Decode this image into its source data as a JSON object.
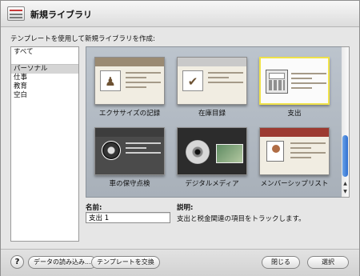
{
  "window": {
    "title": "新規ライブラリ",
    "prompt": "テンプレートを使用して新規ライブラリを作成:"
  },
  "categories": {
    "items": [
      {
        "label": "すべて"
      },
      {
        "label": "パーソナル",
        "selected": true
      },
      {
        "label": "仕事"
      },
      {
        "label": "教育"
      },
      {
        "label": "空白"
      }
    ]
  },
  "templates": [
    {
      "label": "エクササイズの記録",
      "icon": "exercise-icon"
    },
    {
      "label": "在庫目録",
      "icon": "inventory-icon"
    },
    {
      "label": "支出",
      "icon": "calculator-icon",
      "selected": true
    },
    {
      "label": "車の保守点検",
      "icon": "tire-icon"
    },
    {
      "label": "デジタルメディア",
      "icon": "disc-icon"
    },
    {
      "label": "メンバーシップリスト",
      "icon": "member-card-icon"
    }
  ],
  "details": {
    "name_label": "名前:",
    "name_value": "支出 1",
    "description_label": "説明:",
    "description_text": "支出と税金関連の項目をトラックします。"
  },
  "footer": {
    "help_label": "?",
    "import_label": "データの読み込み...",
    "swap_template_label": "テンプレートを交換",
    "close_label": "閉じる",
    "select_label": "選択"
  },
  "colors": {
    "selection_border": "#f0e24a",
    "scroll_thumb": "#2f6fd0",
    "gallery_background": "#b4bcc5"
  }
}
